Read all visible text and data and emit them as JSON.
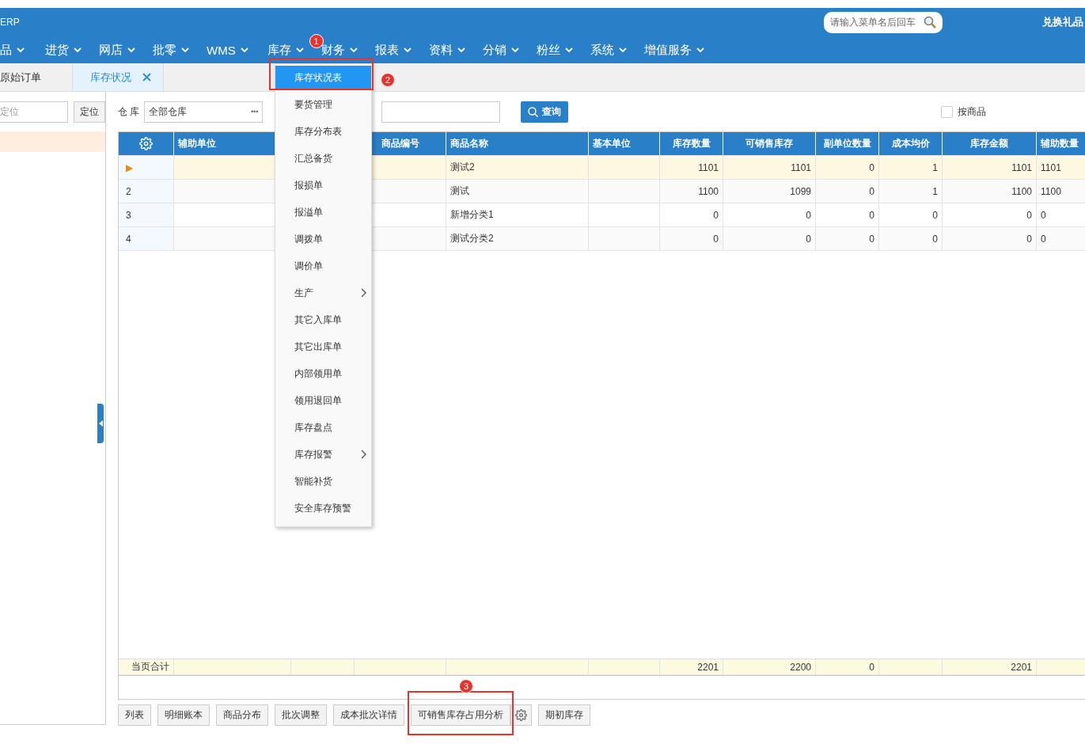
{
  "header": {
    "title": "ERP",
    "search": {
      "placeholder": "请输入菜单名后回车"
    },
    "right_link": "兑换礼品"
  },
  "nav": [
    {
      "label": "品"
    },
    {
      "label": "进货"
    },
    {
      "label": "网店"
    },
    {
      "label": "批零"
    },
    {
      "label": "WMS"
    },
    {
      "label": "库存",
      "badge": "1"
    },
    {
      "label": "财务"
    },
    {
      "label": "报表"
    },
    {
      "label": "资料"
    },
    {
      "label": "分销"
    },
    {
      "label": "粉丝"
    },
    {
      "label": "系统"
    },
    {
      "label": "增值服务"
    }
  ],
  "tabs": [
    {
      "label": "原始订单",
      "selected": false,
      "closable": false
    },
    {
      "label": "库存状况",
      "selected": true,
      "closable": true
    }
  ],
  "menu": [
    {
      "label": "库存状况表",
      "selected": true,
      "submenu": false,
      "badge": "2"
    },
    {
      "label": "要货管理",
      "selected": false,
      "submenu": false
    },
    {
      "label": "库存分布表",
      "selected": false,
      "submenu": false
    },
    {
      "label": "汇总备货",
      "selected": false,
      "submenu": false
    },
    {
      "label": "报损单",
      "selected": false,
      "submenu": false
    },
    {
      "label": "报溢单",
      "selected": false,
      "submenu": false
    },
    {
      "label": "调拨单",
      "selected": false,
      "submenu": false
    },
    {
      "label": "调价单",
      "selected": false,
      "submenu": false
    },
    {
      "label": "生产",
      "selected": false,
      "submenu": true
    },
    {
      "label": "其它入库单",
      "selected": false,
      "submenu": false
    },
    {
      "label": "其它出库单",
      "selected": false,
      "submenu": false
    },
    {
      "label": "内部领用单",
      "selected": false,
      "submenu": false
    },
    {
      "label": "领用退回单",
      "selected": false,
      "submenu": false
    },
    {
      "label": "库存盘点",
      "selected": false,
      "submenu": false
    },
    {
      "label": "库存报警",
      "selected": false,
      "submenu": true
    },
    {
      "label": "智能补货",
      "selected": false,
      "submenu": false
    },
    {
      "label": "安全库存预警",
      "selected": false,
      "submenu": false
    }
  ],
  "left_panel": {
    "locate_placeholder": "定位",
    "locate_button": "定位",
    "items": [
      {
        "selected": true
      }
    ]
  },
  "filters": {
    "warehouse_label": "仓 库",
    "warehouse_value": "全部仓库",
    "warehouse_more": "•••",
    "query_button": "查询",
    "by_product": {
      "label": "按商品",
      "checked": false
    }
  },
  "table": {
    "columns": [
      "辅助单位",
      null,
      "商品编号",
      "商品名称",
      "基本单位",
      "库存数量",
      "可销售库存",
      "副单位数量",
      "成本均价",
      "库存金额",
      "辅助数量"
    ],
    "rows": [
      {
        "row_header": "▶",
        "selected": true,
        "cells": [
          null,
          null,
          null,
          "测试2",
          null,
          "1101",
          "1101",
          "0",
          "1",
          "1101",
          "1101"
        ]
      },
      {
        "row_header": "2",
        "selected": false,
        "cells": [
          null,
          null,
          null,
          "测试",
          null,
          "1100",
          "1099",
          "0",
          "1",
          "1100",
          "1100"
        ]
      },
      {
        "row_header": "3",
        "selected": false,
        "cells": [
          null,
          null,
          null,
          "新增分类1",
          null,
          "0",
          "0",
          "0",
          "0",
          "0",
          "0"
        ]
      },
      {
        "row_header": "4",
        "selected": false,
        "cells": [
          null,
          null,
          null,
          "测试分类2",
          null,
          "0",
          "0",
          "0",
          "0",
          "0",
          "0"
        ]
      }
    ],
    "totals": {
      "label": "当页合计",
      "cells": [
        null,
        null,
        null,
        null,
        null,
        "2201",
        "2200",
        "0",
        null,
        "2201",
        null
      ]
    }
  },
  "footer_buttons": [
    {
      "kind": "text",
      "label": "列表"
    },
    {
      "kind": "text",
      "label": "明细账本"
    },
    {
      "kind": "text",
      "label": "商品分布"
    },
    {
      "kind": "text",
      "label": "批次调整"
    },
    {
      "kind": "text",
      "label": "成本批次详情"
    },
    {
      "kind": "text",
      "label": "可销售库存占用分析",
      "badge": "3"
    },
    {
      "kind": "gear"
    },
    {
      "kind": "text",
      "label": "期初库存"
    }
  ]
}
